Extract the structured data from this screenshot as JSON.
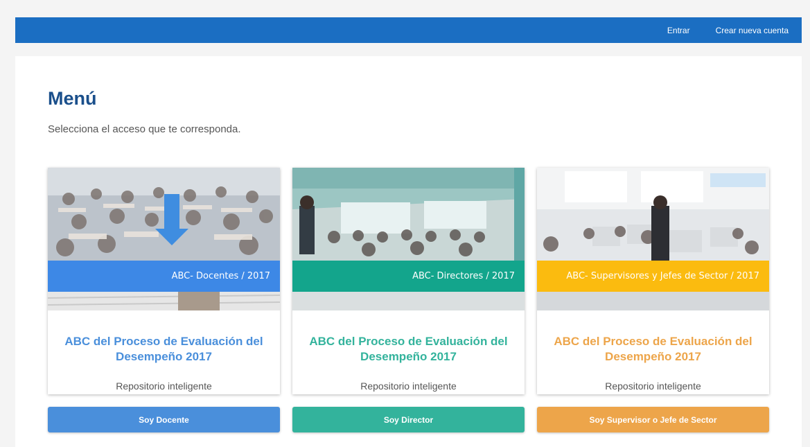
{
  "nav": {
    "login_label": "Entrar",
    "signup_label": "Crear nueva cuenta"
  },
  "header": {
    "title": "Menú",
    "subtitle": "Selecciona el acceso que te corresponda."
  },
  "cards": [
    {
      "banner": "ABC- Docentes / 2017",
      "title": "ABC del Proceso de Evaluación del Desempeño 2017",
      "subtitle": "Repositorio inteligente",
      "button": "Soy Docente",
      "color": "#4a8fdb",
      "banner_color": "#3d88e6",
      "image": "classroom-teachers-exam-photo"
    },
    {
      "banner": "ABC- Directores / 2017",
      "title": "ABC del Proceso de Evaluación del Desempeño 2017",
      "subtitle": "Repositorio inteligente",
      "button": "Soy Director",
      "color": "#33b39c",
      "banner_color": "#13a58c",
      "image": "classroom-directors-photo"
    },
    {
      "banner": "ABC- Supervisores y Jefes de Sector / 2017",
      "title": "ABC del Proceso de Evaluación del Desempeño 2017",
      "subtitle": "Repositorio inteligente",
      "button": "Soy Supervisor o Jefe de Sector",
      "color": "#eda54a",
      "banner_color": "#fbbb0f",
      "image": "computer-lab-supervisors-photo"
    }
  ]
}
